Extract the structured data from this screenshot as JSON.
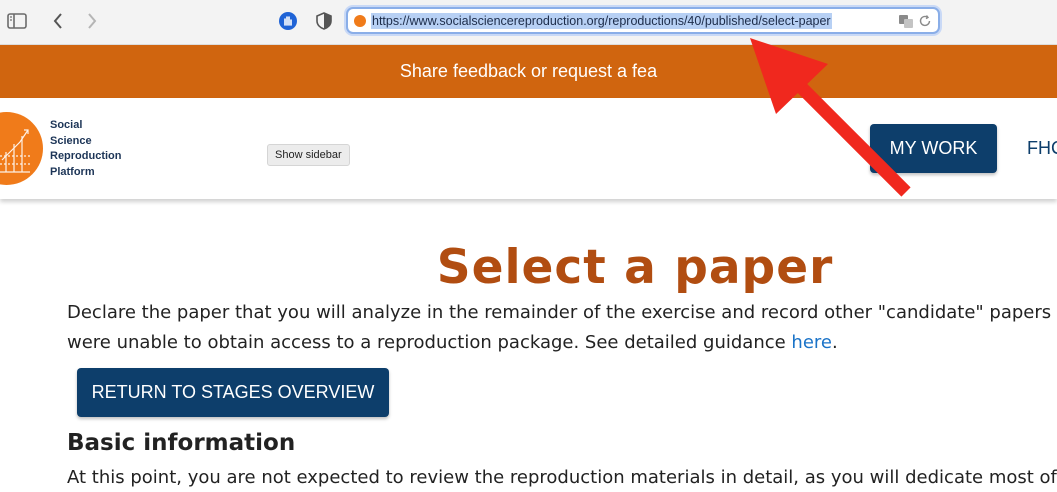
{
  "browser": {
    "url": "https://www.socialsciencereproduction.org/reproductions/40/published/select-paper"
  },
  "banner": {
    "text": "Share feedback or request a fea"
  },
  "header": {
    "logo_lines": [
      "Social",
      "Science",
      "Reproduction",
      "Platform"
    ],
    "show_sidebar_label": "Show sidebar",
    "my_work_label": "MY WORK",
    "nav_next_label": "FHC"
  },
  "main": {
    "title": "Select a paper",
    "intro_line1": "Declare the paper that you will analyze in the remainder of the exercise and record other \"candidate\" papers fo",
    "intro_line2_prefix": "were unable to obtain access to a reproduction package. See detailed guidance ",
    "intro_link": "here",
    "intro_line2_suffix": ".",
    "return_button": "RETURN TO STAGES OVERVIEW",
    "section_heading": "Basic information",
    "cut_paragraph": "At this point, you are not expected to review the reproduction materials in detail, as you will dedicate most of"
  },
  "colors": {
    "banner": "#d0650f",
    "primary_button": "#0d3e6b",
    "title": "#b14d11",
    "link": "#1a73c8",
    "annotation_arrow": "#f0281e"
  }
}
